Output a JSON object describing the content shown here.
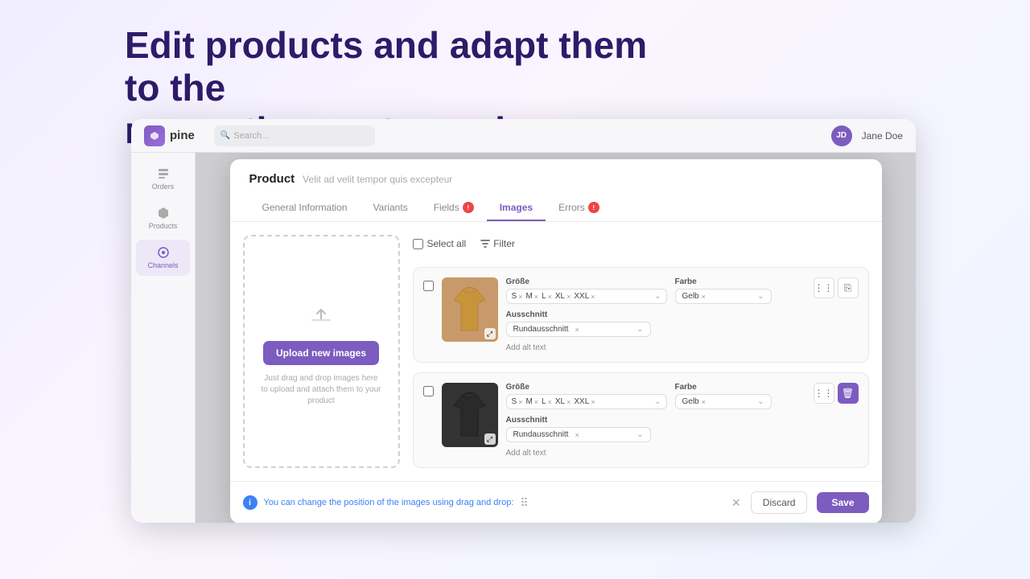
{
  "headline": {
    "line1": "Edit products and adapt them to the",
    "line2": "respective customer base"
  },
  "app": {
    "logo_text": "pine",
    "search_placeholder": "Search...",
    "username": "Jane Doe",
    "avatar_initials": "JD"
  },
  "sidebar": {
    "items": [
      {
        "label": "Orders",
        "icon": "orders"
      },
      {
        "label": "Products",
        "icon": "products"
      },
      {
        "label": "Channels",
        "icon": "channels",
        "active": true
      }
    ]
  },
  "modal": {
    "title": "Product",
    "subtitle": "Velit ad velit tempor quis excepteur",
    "tabs": [
      {
        "label": "General Information",
        "active": false
      },
      {
        "label": "Variants",
        "active": false
      },
      {
        "label": "Fields",
        "active": false,
        "badge": true
      },
      {
        "label": "Images",
        "active": true
      },
      {
        "label": "Errors",
        "active": false,
        "badge": true
      }
    ],
    "toolbar": {
      "select_all": "Select all",
      "filter": "Filter"
    },
    "upload": {
      "btn_label": "Upload new images",
      "hint_line1": "Just drag and drop images here",
      "hint_line2": "to upload and attach them to your product"
    },
    "products": [
      {
        "id": 1,
        "color": "yellow",
        "size_label": "Größe",
        "sizes": [
          "S",
          "M",
          "L",
          "XL",
          "XXL"
        ],
        "farbe_label": "Farbe",
        "farbe": "Gelb",
        "ausschnitt_label": "Ausschnitt",
        "ausschnitt": "Rundausschnitt",
        "add_alt_text": "Add alt text"
      },
      {
        "id": 2,
        "color": "black",
        "size_label": "Größe",
        "sizes": [
          "S",
          "M",
          "L",
          "XL",
          "XXL"
        ],
        "farbe_label": "Farbe",
        "farbe": "Gelb",
        "ausschnitt_label": "Ausschnitt",
        "ausschnitt": "Rundausschnitt",
        "add_alt_text": "Add alt text"
      }
    ],
    "footer": {
      "info_text": "You can change the position of the images using drag and drop:",
      "discard_label": "Discard",
      "save_label": "Save"
    }
  }
}
